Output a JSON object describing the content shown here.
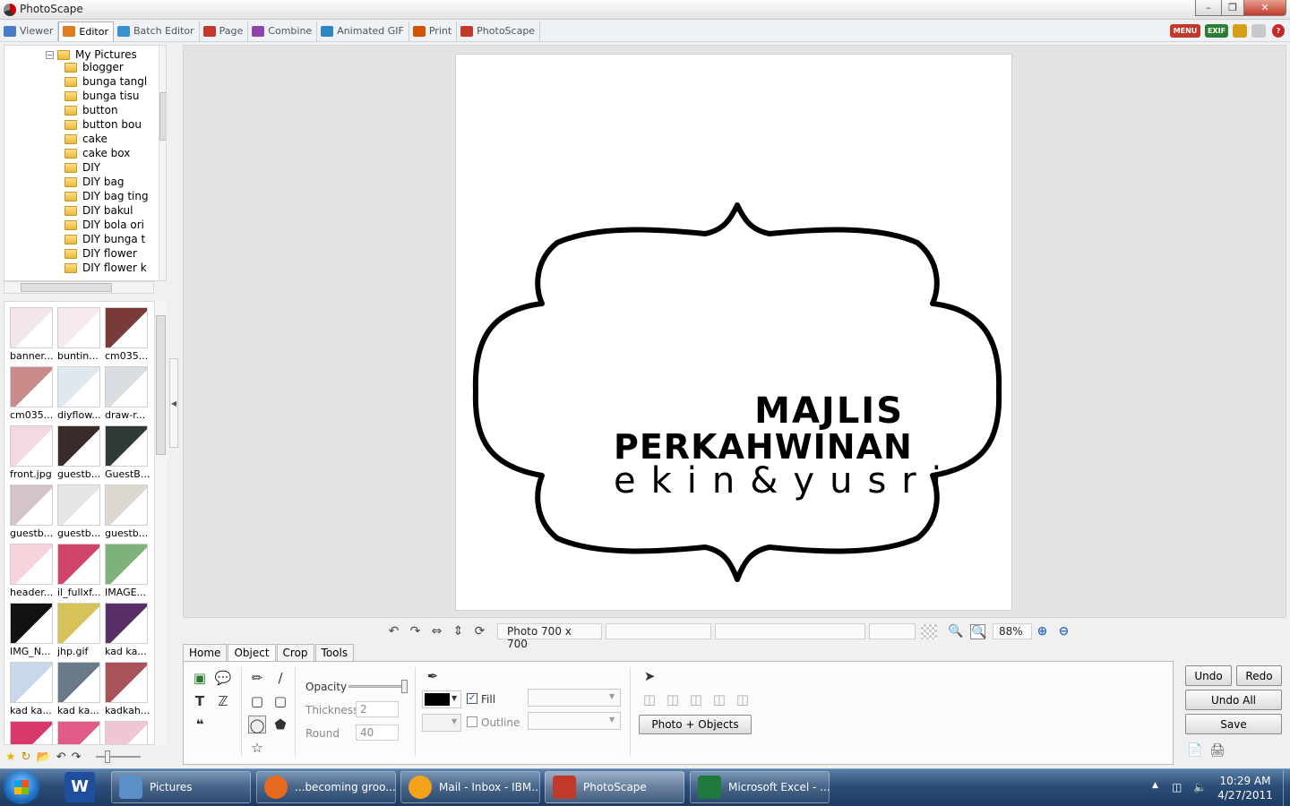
{
  "window": {
    "title": "PhotoScape",
    "min_icon": "minimize-icon",
    "max_icon": "maximize-icon",
    "close_icon": "close-icon"
  },
  "tabs": [
    {
      "label": "Viewer",
      "icon": "viewer-icon",
      "color": "#4a7bc8"
    },
    {
      "label": "Editor",
      "icon": "editor-icon",
      "color": "#e07b1f",
      "active": true
    },
    {
      "label": "Batch Editor",
      "icon": "batch-editor-icon",
      "color": "#3a8fd1"
    },
    {
      "label": "Page",
      "icon": "page-icon",
      "color": "#c0392b"
    },
    {
      "label": "Combine",
      "icon": "combine-icon",
      "color": "#8e44ad"
    },
    {
      "label": "Animated GIF",
      "icon": "animated-gif-icon",
      "color": "#2e86c1"
    },
    {
      "label": "Print",
      "icon": "print-icon",
      "color": "#d35400"
    },
    {
      "label": "PhotoScape",
      "icon": "photoscape-icon",
      "color": "#c0392b"
    }
  ],
  "right_tools": {
    "menu": "MENU",
    "exif": "EXIF"
  },
  "tree": {
    "root": "My Pictures",
    "items": [
      {
        "label": "blogger",
        "expandable": true
      },
      {
        "label": "bunga tangl",
        "expandable": false
      },
      {
        "label": "bunga tisu",
        "expandable": false
      },
      {
        "label": "button",
        "expandable": false
      },
      {
        "label": "button bou",
        "expandable": false
      },
      {
        "label": "cake",
        "expandable": false
      },
      {
        "label": "cake box",
        "expandable": false
      },
      {
        "label": "DIY",
        "expandable": false
      },
      {
        "label": "DIY bag",
        "expandable": false
      },
      {
        "label": "DIY bag ting",
        "expandable": false
      },
      {
        "label": "DIY bakul",
        "expandable": false
      },
      {
        "label": "DIY bola ori",
        "expandable": false
      },
      {
        "label": "DIY bunga t",
        "expandable": false
      },
      {
        "label": "DIY flower",
        "expandable": true
      },
      {
        "label": "DIY flower k",
        "expandable": true
      }
    ]
  },
  "thumbnails": [
    {
      "caption": "banner...",
      "color": "#f2e6ea"
    },
    {
      "caption": "buntin...",
      "color": "#f7e9f0"
    },
    {
      "caption": "cm035...",
      "color": "#7a3a3a"
    },
    {
      "caption": "cm035...",
      "color": "#c98a8a"
    },
    {
      "caption": "diyflow...",
      "color": "#dfe8ef"
    },
    {
      "caption": "draw-r...",
      "color": "#d9dde2"
    },
    {
      "caption": "front.jpg",
      "color": "#f3d9e3"
    },
    {
      "caption": "guestb...",
      "color": "#3a2a2a"
    },
    {
      "caption": "GuestB...",
      "color": "#2f3a36"
    },
    {
      "caption": "guestb...",
      "color": "#d4c4c8"
    },
    {
      "caption": "guestb...",
      "color": "#e6e6e6"
    },
    {
      "caption": "guestb...",
      "color": "#dcd8cf"
    },
    {
      "caption": "header...",
      "color": "#f7d4dc"
    },
    {
      "caption": "il_fullxf...",
      "color": "#d2456a"
    },
    {
      "caption": "IMAGE...",
      "color": "#7fb27a"
    },
    {
      "caption": "IMG_N...",
      "color": "#121212"
    },
    {
      "caption": "jhp.gif",
      "color": "#d7c25a"
    },
    {
      "caption": "kad ka...",
      "color": "#5a2e66"
    },
    {
      "caption": "kad ka...",
      "color": "#c7d8e8"
    },
    {
      "caption": "kad ka...",
      "color": "#6a7a88"
    },
    {
      "caption": "kadkah...",
      "color": "#a8525a"
    },
    {
      "caption": "",
      "color": "#d9386a"
    },
    {
      "caption": "",
      "color": "#e05a8a"
    },
    {
      "caption": "",
      "color": "#f0c6d6"
    }
  ],
  "canvas": {
    "text_line1": "MAJLIS",
    "text_line2": "PERKAHWINAN",
    "text_line3": "ekin&yusri"
  },
  "status": {
    "photo_size": "Photo 700 x 700",
    "zoom": "88%"
  },
  "panel": {
    "tabs": [
      "Home",
      "Object",
      "Crop",
      "Tools"
    ],
    "active_tab": "Object",
    "opacity_label": "Opacity",
    "thickness_label": "Thickness",
    "thickness_value": "2",
    "round_label": "Round",
    "round_value": "40",
    "fill_label": "Fill",
    "outline_label": "Outline",
    "photo_objects_button": "Photo + Objects",
    "fill_color": "#000000"
  },
  "actions": {
    "undo": "Undo",
    "redo": "Redo",
    "undo_all": "Undo All",
    "save": "Save"
  },
  "taskbar": {
    "items": [
      {
        "label": "Pictures",
        "icon": "explorer-icon",
        "color": "#5b8fc7"
      },
      {
        "label": "...becoming groo...",
        "icon": "firefox-icon",
        "color": "#e86a1f"
      },
      {
        "label": "Mail - Inbox - IBM...",
        "icon": "lotus-notes-icon",
        "color": "#f2a31b"
      },
      {
        "label": "PhotoScape",
        "icon": "photoscape-icon",
        "color": "#c0392b"
      },
      {
        "label": "Microsoft Excel - ...",
        "icon": "excel-icon",
        "color": "#1e7a3c"
      }
    ],
    "time": "10:29 AM",
    "date": "4/27/2011"
  }
}
